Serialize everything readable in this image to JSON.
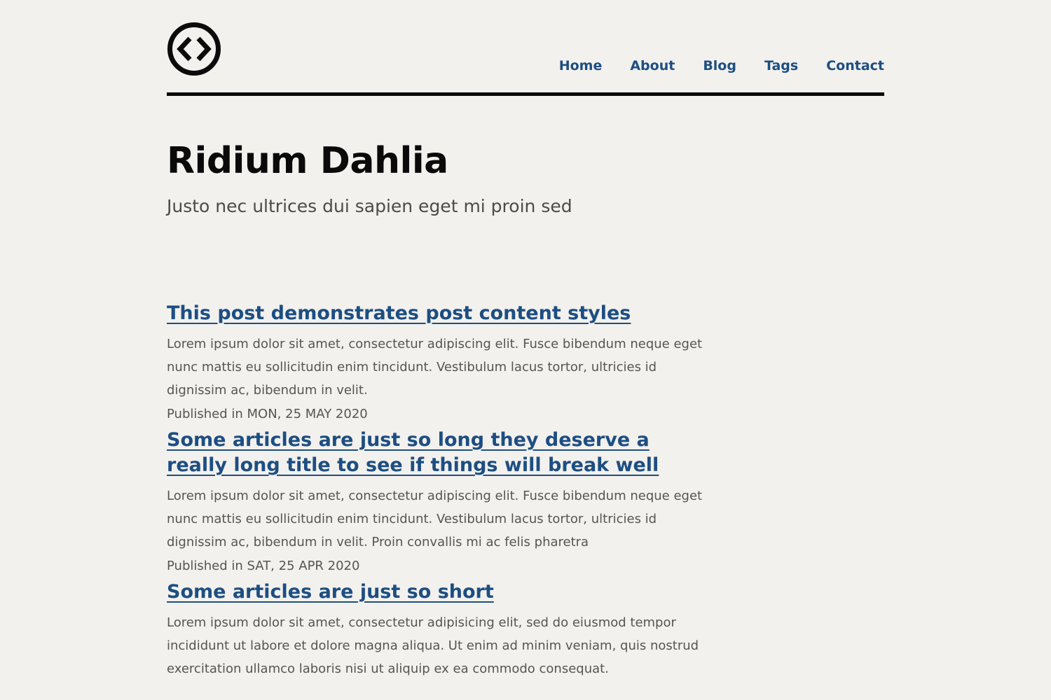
{
  "header": {
    "logo_icon": "code-brackets-circle-icon",
    "nav": {
      "items": [
        {
          "label": "Home"
        },
        {
          "label": "About"
        },
        {
          "label": "Blog"
        },
        {
          "label": "Tags"
        },
        {
          "label": "Contact"
        }
      ]
    }
  },
  "hero": {
    "title": "Ridium Dahlia",
    "subtitle": "Justo nec ultrices dui sapien eget mi proin sed"
  },
  "posts": [
    {
      "title": "This post demonstrates post content styles",
      "excerpt": "Lorem ipsum dolor sit amet, consectetur adipiscing elit. Fusce bibendum neque eget nunc mattis eu sollicitudin enim tincidunt. Vestibulum lacus tortor, ultricies id dignissim ac, bibendum in velit.",
      "meta": "Published in MON, 25 MAY 2020"
    },
    {
      "title": "Some articles are just so long they deserve a really long title to see if things will break well",
      "excerpt": "Lorem ipsum dolor sit amet, consectetur adipiscing elit. Fusce bibendum neque eget nunc mattis eu sollicitudin enim tincidunt. Vestibulum lacus tortor, ultricies id dignissim ac, bibendum in velit. Proin convallis mi ac felis pharetra",
      "meta": "Published in SAT, 25 APR 2020"
    },
    {
      "title": "Some articles are just so short",
      "excerpt": "Lorem ipsum dolor sit amet, consectetur adipisicing elit, sed do eiusmod tempor incididunt ut labore et dolore magna aliqua. Ut enim ad minim veniam, quis nostrud exercitation ullamco laboris nisi ut aliquip ex ea commodo consequat.",
      "meta": ""
    }
  ],
  "colors": {
    "background": "#f2f1ed",
    "link": "#1d4e82",
    "text": "#555555",
    "title": "#0a0a0a"
  }
}
